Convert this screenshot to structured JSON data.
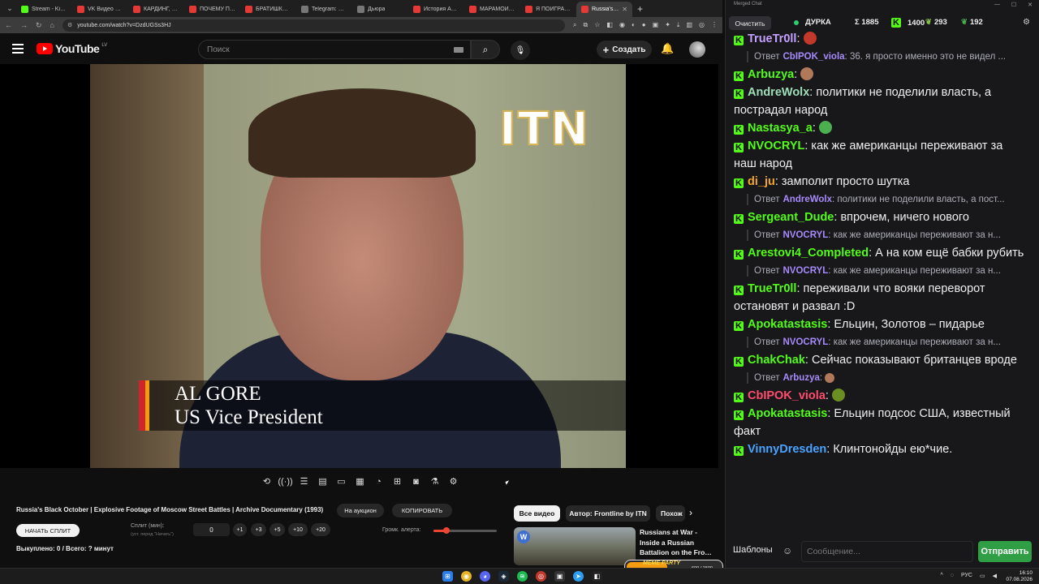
{
  "browser": {
    "tabs": [
      {
        "title": "Stream - Ki…",
        "color": "#53fc18"
      },
      {
        "title": "VK Видео Li…",
        "color": "#e53935"
      },
      {
        "title": "КАРДИНГ, б…",
        "color": "#e53935"
      },
      {
        "title": "ПОЧЕМУ ПА…",
        "color": "#e53935"
      },
      {
        "title": "БРАТИШКИ…",
        "color": "#e53935"
      },
      {
        "title": "Telegram: V…",
        "color": "#777777"
      },
      {
        "title": "Дьюра",
        "color": "#777777"
      },
      {
        "title": "История Ар…",
        "color": "#e53935"
      },
      {
        "title": "МАРАМОЙ…",
        "color": "#e53935"
      },
      {
        "title": "Я ПОИГРАЛ…",
        "color": "#e53935"
      },
      {
        "title": "Russia's…",
        "color": "#e53935",
        "active": true
      }
    ],
    "url": "youtube.com/watch?v=DzdUGSs3HJ"
  },
  "youtube": {
    "logo_text": "YouTube",
    "region": "LV",
    "search_placeholder": "Поиск",
    "create_label": "Создать"
  },
  "video": {
    "overlay_logo": "ITN",
    "lower_third_name": "AL GORE",
    "lower_third_role": "US Vice President"
  },
  "extension": {
    "video_title": "Russia's Black October | Explosive Footage of Moscow Street Battles | Archive Documentary (1993)",
    "auction_label": "На аукцион",
    "copy_label": "КОПИРОВАТЬ",
    "start_split_label": "НАЧАТЬ СПЛИТ",
    "split_label": "Сплит (мин):",
    "split_hint": "(уст. перед \"Начать\")",
    "split_value": "0",
    "increments": [
      "+1",
      "+3",
      "+5",
      "+10",
      "+20"
    ],
    "alert_volume_label": "Громк. алерта:",
    "alert_volume": 0.2,
    "sold_line": "Выкуплено: 0 / Всего: ? минут"
  },
  "related": {
    "chips": [
      "Все видео",
      "Автор: Frontline by ITN",
      "Похож"
    ],
    "video_title": "Russians at War - Inside a Russian Battalion on the Fro…",
    "thumb_logo": "W"
  },
  "widget": {
    "label": "MEME PARTY",
    "count": "600 / 1500"
  },
  "chat": {
    "window_title": "Merged Chat",
    "clear_label": "Очистить",
    "channel": "ДУРКА",
    "stats": {
      "sigma": "Σ 1885",
      "kick": "1400",
      "viewers_a": "293",
      "viewers_b": "192"
    },
    "reply_prefix": "Ответ",
    "messages": [
      {
        "user": "TrueTr0ll",
        "color": "#c6a0ff",
        "text": "",
        "emote": "#c0392b"
      },
      {
        "reply_to": "CbIPOK_viola",
        "reply_color": "#a78bfa",
        "reply_text": "36. я просто именно это не видел ..."
      },
      {
        "user": "Arbuzya",
        "color": "#53fc18",
        "text": "",
        "emote": "#b07a5a"
      },
      {
        "user": "AndreWolx",
        "color": "#9fdfb8",
        "text": "политики не поделили власть, а пострадал народ"
      },
      {
        "user": "Nastasya_a",
        "color": "#53fc18",
        "text": "",
        "emote": "#4caf50"
      },
      {
        "user": "NVOCRYL",
        "color": "#53fc18",
        "text": "как же американцы переживают за наш народ"
      },
      {
        "user": "di_ju",
        "color": "#f5a623",
        "text": "замполит просто шутка"
      },
      {
        "reply_to": "AndreWolx",
        "reply_color": "#a78bfa",
        "reply_text": "политики не поделили власть, а пост..."
      },
      {
        "user": "Sergeant_Dude",
        "color": "#53fc18",
        "text": "впрочем, ничего нового"
      },
      {
        "reply_to": "NVOCRYL",
        "reply_color": "#a78bfa",
        "reply_text": "как же американцы переживают за н..."
      },
      {
        "user": "Arestovi4_Completed",
        "color": "#53fc18",
        "text": "А на ком ещё бабки рубить"
      },
      {
        "reply_to": "NVOCRYL",
        "reply_color": "#a78bfa",
        "reply_text": "как же американцы переживают за н..."
      },
      {
        "user": "TrueTr0ll",
        "color": "#53fc18",
        "text": "переживали что вояки переворот остановят и развал :D"
      },
      {
        "user": "Apokatastasis",
        "color": "#53fc18",
        "text": "Ельцин, Золотов – пидарье"
      },
      {
        "reply_to": "NVOCRYL",
        "reply_color": "#a78bfa",
        "reply_text": "как же американцы переживают за н..."
      },
      {
        "user": "ChakChak",
        "color": "#53fc18",
        "text": "Сейчас показывают британцев вроде"
      },
      {
        "reply_to": "Arbuzya",
        "reply_color": "#a78bfa",
        "reply_text": "",
        "reply_emote": "#b07a5a"
      },
      {
        "user": "CbIPOK_viola",
        "color": "#ff4d6d",
        "text": "",
        "emote": "#6b8e23"
      },
      {
        "user": "Apokatastasis",
        "color": "#53fc18",
        "text": "Ельцин подсос США, известный факт"
      },
      {
        "user": "VinnyDresden",
        "color": "#4aa3ff",
        "text": "Клинтонойды ею*чие."
      }
    ],
    "templates_label": "Шаблоны",
    "input_placeholder": "Сообщение...",
    "send_label": "Отправить"
  },
  "taskbar": {
    "lang": "РУС",
    "time": "16:10",
    "date": "07.08.2026"
  }
}
